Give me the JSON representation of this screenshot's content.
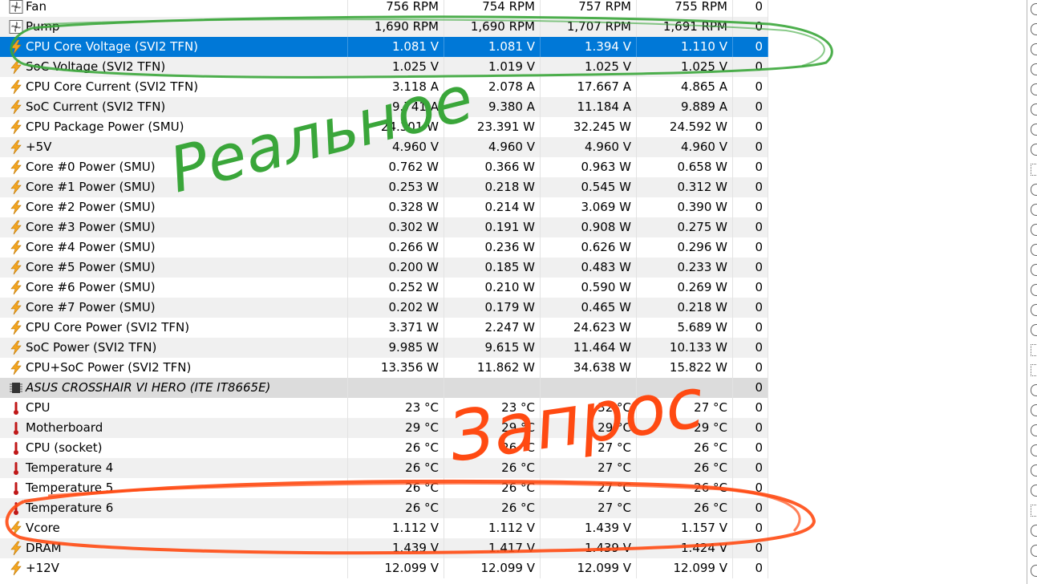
{
  "rows": [
    {
      "icon": "fan-icon",
      "name": "Fan",
      "v": [
        "756 RPM",
        "754 RPM",
        "757 RPM",
        "755 RPM"
      ],
      "count": "0"
    },
    {
      "icon": "fan-icon",
      "name": "Pump",
      "v": [
        "1,690 RPM",
        "1,690 RPM",
        "1,707 RPM",
        "1,691 RPM"
      ],
      "count": "0"
    },
    {
      "icon": "bolt-icon",
      "name": "CPU Core Voltage (SVI2 TFN)",
      "v": [
        "1.081 V",
        "1.081 V",
        "1.394 V",
        "1.110 V"
      ],
      "count": "0",
      "selected": true
    },
    {
      "icon": "bolt-icon",
      "name": "SoC Voltage (SVI2 TFN)",
      "v": [
        "1.025 V",
        "1.019 V",
        "1.025 V",
        "1.025 V"
      ],
      "count": "0"
    },
    {
      "icon": "bolt-icon",
      "name": "CPU Core Current (SVI2 TFN)",
      "v": [
        "3.118 A",
        "2.078 A",
        "17.667 A",
        "4.865 A"
      ],
      "count": "0"
    },
    {
      "icon": "bolt-icon",
      "name": "SoC Current (SVI2 TFN)",
      "v": [
        "9.741 A",
        "9.380 A",
        "11.184 A",
        "9.889 A"
      ],
      "count": "0"
    },
    {
      "icon": "bolt-icon",
      "name": "CPU Package Power (SMU)",
      "v": [
        "24.301 W",
        "23.391 W",
        "32.245 W",
        "24.592 W"
      ],
      "count": "0"
    },
    {
      "icon": "bolt-icon",
      "name": "+5V",
      "v": [
        "4.960 V",
        "4.960 V",
        "4.960 V",
        "4.960 V"
      ],
      "count": "0"
    },
    {
      "icon": "bolt-icon",
      "name": "Core #0 Power (SMU)",
      "v": [
        "0.762 W",
        "0.366 W",
        "0.963 W",
        "0.658 W"
      ],
      "count": "0"
    },
    {
      "icon": "bolt-icon",
      "name": "Core #1 Power (SMU)",
      "v": [
        "0.253 W",
        "0.218 W",
        "0.545 W",
        "0.312 W"
      ],
      "count": "0"
    },
    {
      "icon": "bolt-icon",
      "name": "Core #2 Power (SMU)",
      "v": [
        "0.328 W",
        "0.214 W",
        "3.069 W",
        "0.390 W"
      ],
      "count": "0"
    },
    {
      "icon": "bolt-icon",
      "name": "Core #3 Power (SMU)",
      "v": [
        "0.302 W",
        "0.191 W",
        "0.908 W",
        "0.275 W"
      ],
      "count": "0"
    },
    {
      "icon": "bolt-icon",
      "name": "Core #4 Power (SMU)",
      "v": [
        "0.266 W",
        "0.236 W",
        "0.626 W",
        "0.296 W"
      ],
      "count": "0"
    },
    {
      "icon": "bolt-icon",
      "name": "Core #5 Power (SMU)",
      "v": [
        "0.200 W",
        "0.185 W",
        "0.483 W",
        "0.233 W"
      ],
      "count": "0"
    },
    {
      "icon": "bolt-icon",
      "name": "Core #6 Power (SMU)",
      "v": [
        "0.252 W",
        "0.210 W",
        "0.590 W",
        "0.269 W"
      ],
      "count": "0"
    },
    {
      "icon": "bolt-icon",
      "name": "Core #7 Power (SMU)",
      "v": [
        "0.202 W",
        "0.179 W",
        "0.465 W",
        "0.218 W"
      ],
      "count": "0"
    },
    {
      "icon": "bolt-icon",
      "name": "CPU Core Power (SVI2 TFN)",
      "v": [
        "3.371 W",
        "2.247 W",
        "24.623 W",
        "5.689 W"
      ],
      "count": "0"
    },
    {
      "icon": "bolt-icon",
      "name": "SoC Power (SVI2 TFN)",
      "v": [
        "9.985 W",
        "9.615 W",
        "11.464 W",
        "10.133 W"
      ],
      "count": "0"
    },
    {
      "icon": "bolt-icon",
      "name": "CPU+SoC Power (SVI2 TFN)",
      "v": [
        "13.356 W",
        "11.862 W",
        "34.638 W",
        "15.822 W"
      ],
      "count": "0"
    },
    {
      "icon": "chip-icon",
      "name": "ASUS CROSSHAIR VI HERO (ITE IT8665E)",
      "v": [
        "",
        "",
        "",
        ""
      ],
      "count": "0",
      "group": true
    },
    {
      "icon": "thermometer-icon",
      "name": "CPU",
      "v": [
        "23 °C",
        "23 °C",
        "32 °C",
        "27 °C"
      ],
      "count": "0"
    },
    {
      "icon": "thermometer-icon",
      "name": "Motherboard",
      "v": [
        "29 °C",
        "29 °C",
        "29 °C",
        "29 °C"
      ],
      "count": "0"
    },
    {
      "icon": "thermometer-icon",
      "name": "CPU (socket)",
      "v": [
        "26 °C",
        "26 °C",
        "27 °C",
        "26 °C"
      ],
      "count": "0"
    },
    {
      "icon": "thermometer-icon",
      "name": "Temperature 4",
      "v": [
        "26 °C",
        "26 °C",
        "27 °C",
        "26 °C"
      ],
      "count": "0"
    },
    {
      "icon": "thermometer-icon",
      "name": "Temperature 5",
      "v": [
        "26 °C",
        "26 °C",
        "27 °C",
        "26 °C"
      ],
      "count": "0"
    },
    {
      "icon": "thermometer-icon",
      "name": "Temperature 6",
      "v": [
        "26 °C",
        "26 °C",
        "27 °C",
        "26 °C"
      ],
      "count": "0"
    },
    {
      "icon": "bolt-icon",
      "name": "Vcore",
      "v": [
        "1.112 V",
        "1.112 V",
        "1.439 V",
        "1.157 V"
      ],
      "count": "0"
    },
    {
      "icon": "bolt-icon",
      "name": "DRAM",
      "v": [
        "1.439 V",
        "1.417 V",
        "1.439 V",
        "1.424 V"
      ],
      "count": "0"
    },
    {
      "icon": "bolt-icon",
      "name": "+12V",
      "v": [
        "12.099 V",
        "12.099 V",
        "12.099 V",
        "12.099 V"
      ],
      "count": "0"
    }
  ],
  "annotations": {
    "green_text": "Реальное",
    "red_text": "Запрос",
    "green_color": "#3aa63a",
    "red_color": "#ff4a12"
  },
  "colors": {
    "selection": "#0078d7",
    "row_alt": "#f0f0f0",
    "bolt": "#f3a521",
    "thermometer": "#c01818"
  }
}
